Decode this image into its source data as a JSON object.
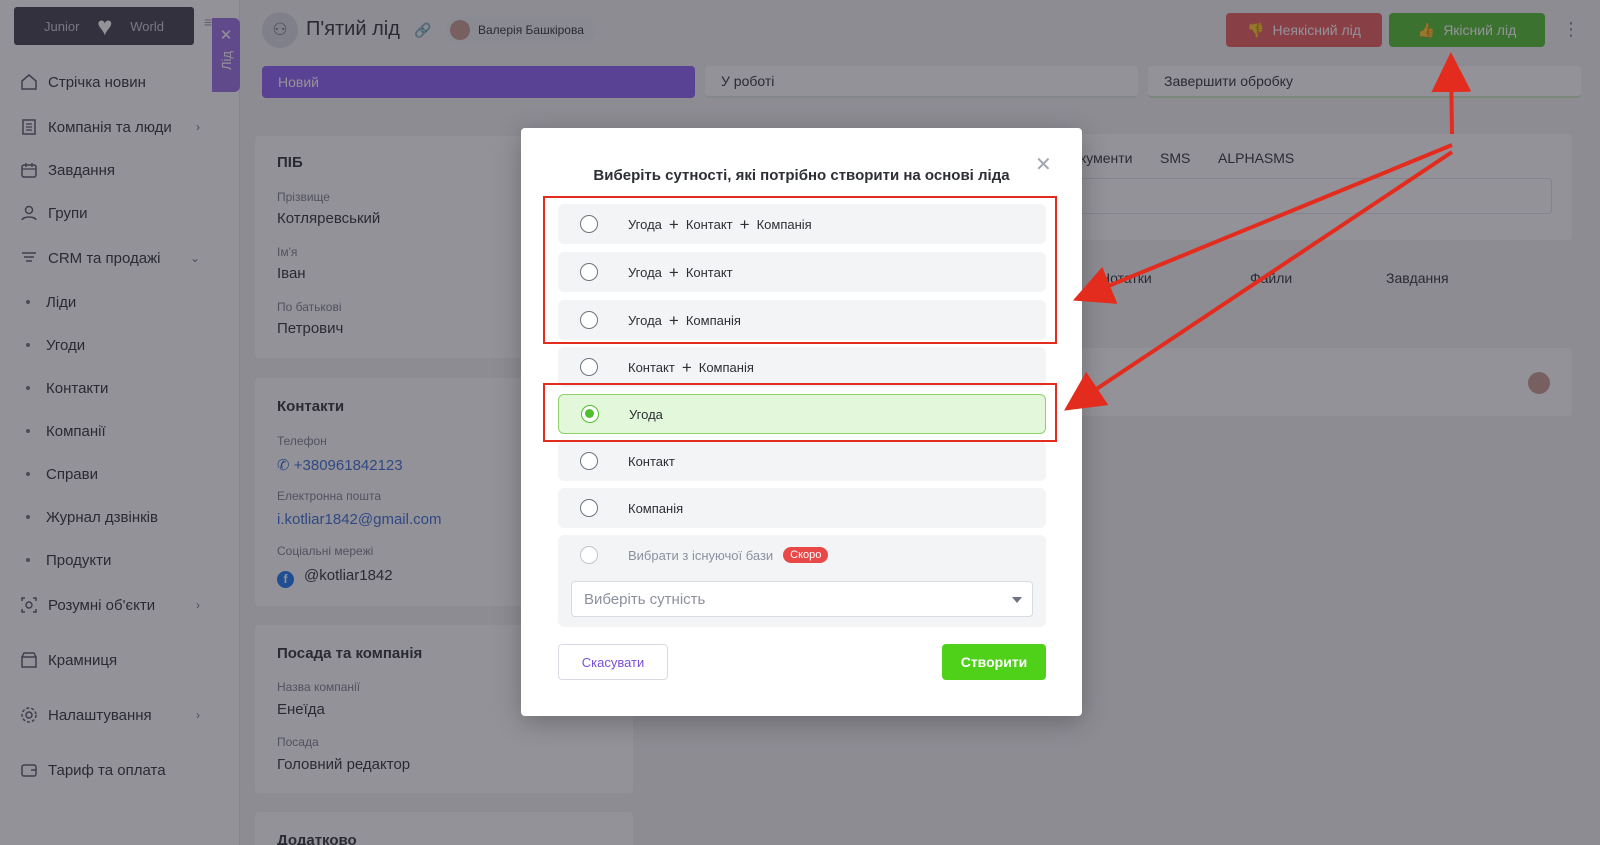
{
  "sidebar": {
    "logo_left": "Junior",
    "logo_right": "World",
    "items": [
      {
        "label": "Стрічка новин",
        "icon": "home-icon"
      },
      {
        "label": "Компанія та люди",
        "icon": "building-icon"
      },
      {
        "label": "Завдання",
        "icon": "calendar-icon"
      },
      {
        "label": "Групи",
        "icon": "users-icon"
      },
      {
        "label": "CRM та продажі",
        "icon": "crm-icon"
      },
      {
        "label": "Розумні об'єкти",
        "icon": "smart-objects-icon"
      },
      {
        "label": "Крамниця",
        "icon": "shop-icon"
      },
      {
        "label": "Налаштування",
        "icon": "gear-icon"
      },
      {
        "label": "Тариф та оплата",
        "icon": "wallet-icon"
      }
    ],
    "crm_sub": [
      "Ліди",
      "Угоди",
      "Контакти",
      "Компанії",
      "Справи",
      "Журнал дзвінків",
      "Продукти"
    ]
  },
  "lead_tab": {
    "label": "Лід"
  },
  "header": {
    "title": "П'ятий лід",
    "user": "Валерія Башкірова",
    "btn_bad": "Неякісний лід",
    "btn_good": "Якісний лід"
  },
  "stages": [
    "Новий",
    "У роботі",
    "Завершити обробку"
  ],
  "cards": {
    "name": {
      "title": "ПІБ",
      "surname_label": "Прізвище",
      "surname": "Котляревський",
      "first_label": "Ім'я",
      "first": "Іван",
      "patronymic_label": "По батькові",
      "patronymic": "Петрович"
    },
    "contacts": {
      "title": "Контакти",
      "phone_label": "Телефон",
      "phone": "+380961842123",
      "email_label": "Електронна пошта",
      "email": "i.kotliar1842@gmail.com",
      "social_label": "Соціальні мережі",
      "social": "@kotliar1842"
    },
    "position": {
      "title": "Посада та компанія",
      "company_label": "Назва компанії",
      "company": "Енеїда",
      "role_label": "Посада",
      "role": "Головний редактор"
    },
    "extra": {
      "title": "Додатково"
    }
  },
  "right_panel": {
    "tabs": [
      "кументи",
      "SMS",
      "ALPHASMS"
    ],
    "tabs2": [
      "Нотатки",
      "Файли",
      "Завдання"
    ]
  },
  "modal": {
    "title": "Виберіть сутності, які потрібно створити на основі ліда",
    "options": [
      {
        "parts": [
          "Угода",
          "Контакт",
          "Компанія"
        ],
        "selected": false
      },
      {
        "parts": [
          "Угода",
          "Контакт"
        ],
        "selected": false
      },
      {
        "parts": [
          "Угода",
          "Компанія"
        ],
        "selected": false
      },
      {
        "parts": [
          "Контакт",
          "Компанія"
        ],
        "selected": false
      },
      {
        "parts": [
          "Угода"
        ],
        "selected": true
      },
      {
        "parts": [
          "Контакт"
        ],
        "selected": false
      },
      {
        "parts": [
          "Компанія"
        ],
        "selected": false
      }
    ],
    "existing_label": "Вибрати з існуючої бази",
    "existing_badge": "Скоро",
    "select_placeholder": "Виберіть сутність",
    "cancel": "Скасувати",
    "create": "Створити"
  },
  "colors": {
    "accent_purple": "#8b5cf6",
    "good_green": "#4fbf2d",
    "bad_red": "#e95a5a",
    "annotation_red": "#e32c1d"
  }
}
